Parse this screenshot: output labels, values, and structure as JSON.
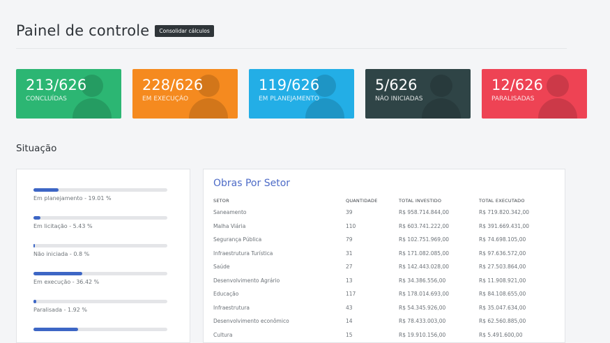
{
  "header": {
    "title": "Painel de controle",
    "consolidate_button": "Consolidar cálculos"
  },
  "cards": [
    {
      "count": "213/626",
      "label": "CONCLUÍDAS",
      "color": "#2cb673"
    },
    {
      "count": "228/626",
      "label": "EM EXECUÇÃO",
      "color": "#f58a1f"
    },
    {
      "count": "119/626",
      "label": "EM PLANEJAMENTO",
      "color": "#23aee6"
    },
    {
      "count": "5/626",
      "label": "NÃO INICIADAS",
      "color": "#2f4446"
    },
    {
      "count": "12/626",
      "label": "PARALISADAS",
      "color": "#ee4354"
    }
  ],
  "situacao": {
    "title": "Situação",
    "items": [
      {
        "label": "Em planejamento - 19.01 %",
        "percent": 19.01
      },
      {
        "label": "Em licitação - 5.43 %",
        "percent": 5.43
      },
      {
        "label": "Não iniciada - 0.8 %",
        "percent": 0.8
      },
      {
        "label": "Em execução - 36.42 %",
        "percent": 36.42
      },
      {
        "label": "Paralisada - 1.92 %",
        "percent": 1.92
      },
      {
        "label": "",
        "percent": 33.5
      }
    ]
  },
  "obras": {
    "title": "Obras Por Setor",
    "columns": [
      "SETOR",
      "QUANTIDADE",
      "TOTAL INVESTIDO",
      "TOTAL EXECUTADO"
    ],
    "rows": [
      [
        "Saneamento",
        "39",
        "R$ 958.714.844,00",
        "R$ 719.820.342,00"
      ],
      [
        "Malha Viária",
        "110",
        "R$ 603.741.222,00",
        "R$ 391.669.431,00"
      ],
      [
        "Segurança Pública",
        "79",
        "R$ 102.751.969,00",
        "R$ 74.698.105,00"
      ],
      [
        "Infraestrutura Turística",
        "31",
        "R$ 171.082.085,00",
        "R$ 97.636.572,00"
      ],
      [
        "Saúde",
        "27",
        "R$ 142.443.028,00",
        "R$ 27.503.864,00"
      ],
      [
        "Desenvolvimento Agrário",
        "13",
        "R$ 34.386.556,00",
        "R$ 11.908.921,00"
      ],
      [
        "Educação",
        "117",
        "R$ 178.014.693,00",
        "R$ 84.108.655,00"
      ],
      [
        "Infraestrutura",
        "43",
        "R$ 54.345.926,00",
        "R$ 35.047.634,00"
      ],
      [
        "Desenvolvimento econômico",
        "14",
        "R$ 78.433.003,00",
        "R$ 62.560.885,00"
      ],
      [
        "Cultura",
        "15",
        "R$ 19.910.156,00",
        "R$ 5.491.600,00"
      ]
    ]
  }
}
